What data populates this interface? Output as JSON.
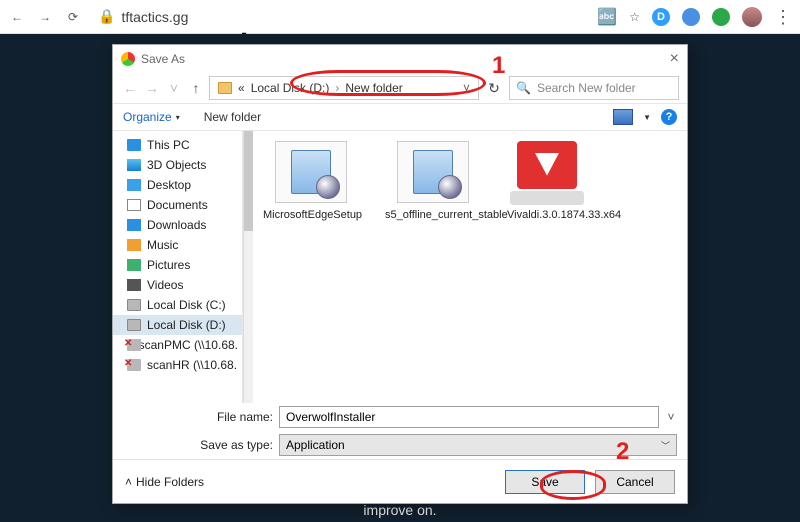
{
  "browser": {
    "url": "tftactics.gg"
  },
  "page_bottom_text": "improve on.",
  "dialog": {
    "title": "Save As",
    "nav": {
      "back_sym": "←",
      "fwd_sym": "→",
      "up_sym": "↑"
    },
    "breadcrumb": {
      "prefix": "«",
      "loc1": "Local Disk (D:)",
      "sep": "›",
      "loc2": "New folder",
      "dropdown": "˅"
    },
    "refresh_sym": "↻",
    "search": {
      "icon": "🔍",
      "placeholder": "Search New folder"
    },
    "toolbar": {
      "organize": "Organize",
      "organize_caret": "▾",
      "new_folder": "New folder",
      "help": "?"
    },
    "tree": [
      {
        "icon": "monitor",
        "label": "This PC"
      },
      {
        "icon": "cube",
        "label": "3D Objects"
      },
      {
        "icon": "desktop",
        "label": "Desktop"
      },
      {
        "icon": "doc",
        "label": "Documents"
      },
      {
        "icon": "dl",
        "label": "Downloads"
      },
      {
        "icon": "music",
        "label": "Music"
      },
      {
        "icon": "pic",
        "label": "Pictures"
      },
      {
        "icon": "vid",
        "label": "Videos"
      },
      {
        "icon": "drive",
        "label": "Local Disk (C:)"
      },
      {
        "icon": "drive",
        "label": "Local Disk (D:)",
        "selected": true
      },
      {
        "icon": "netx",
        "label": "scanPMC (\\\\10.68."
      },
      {
        "icon": "netx",
        "label": "scanHR (\\\\10.68."
      }
    ],
    "files": [
      {
        "kind": "installer",
        "label": "MicrosoftEdgeSetup"
      },
      {
        "kind": "installer",
        "label": "s5_offline_current_stable"
      },
      {
        "kind": "vivaldi",
        "label": "Vivaldi.3.0.1874.33.x64"
      }
    ],
    "filename_label": "File name:",
    "filename_value": "OverwolfInstaller",
    "type_label": "Save as type:",
    "type_value": "Application",
    "hide_folders_sym": "˄",
    "hide_folders": "Hide Folders",
    "save": "Save",
    "cancel": "Cancel"
  },
  "annotations": {
    "num1": "1",
    "num2": "2"
  }
}
